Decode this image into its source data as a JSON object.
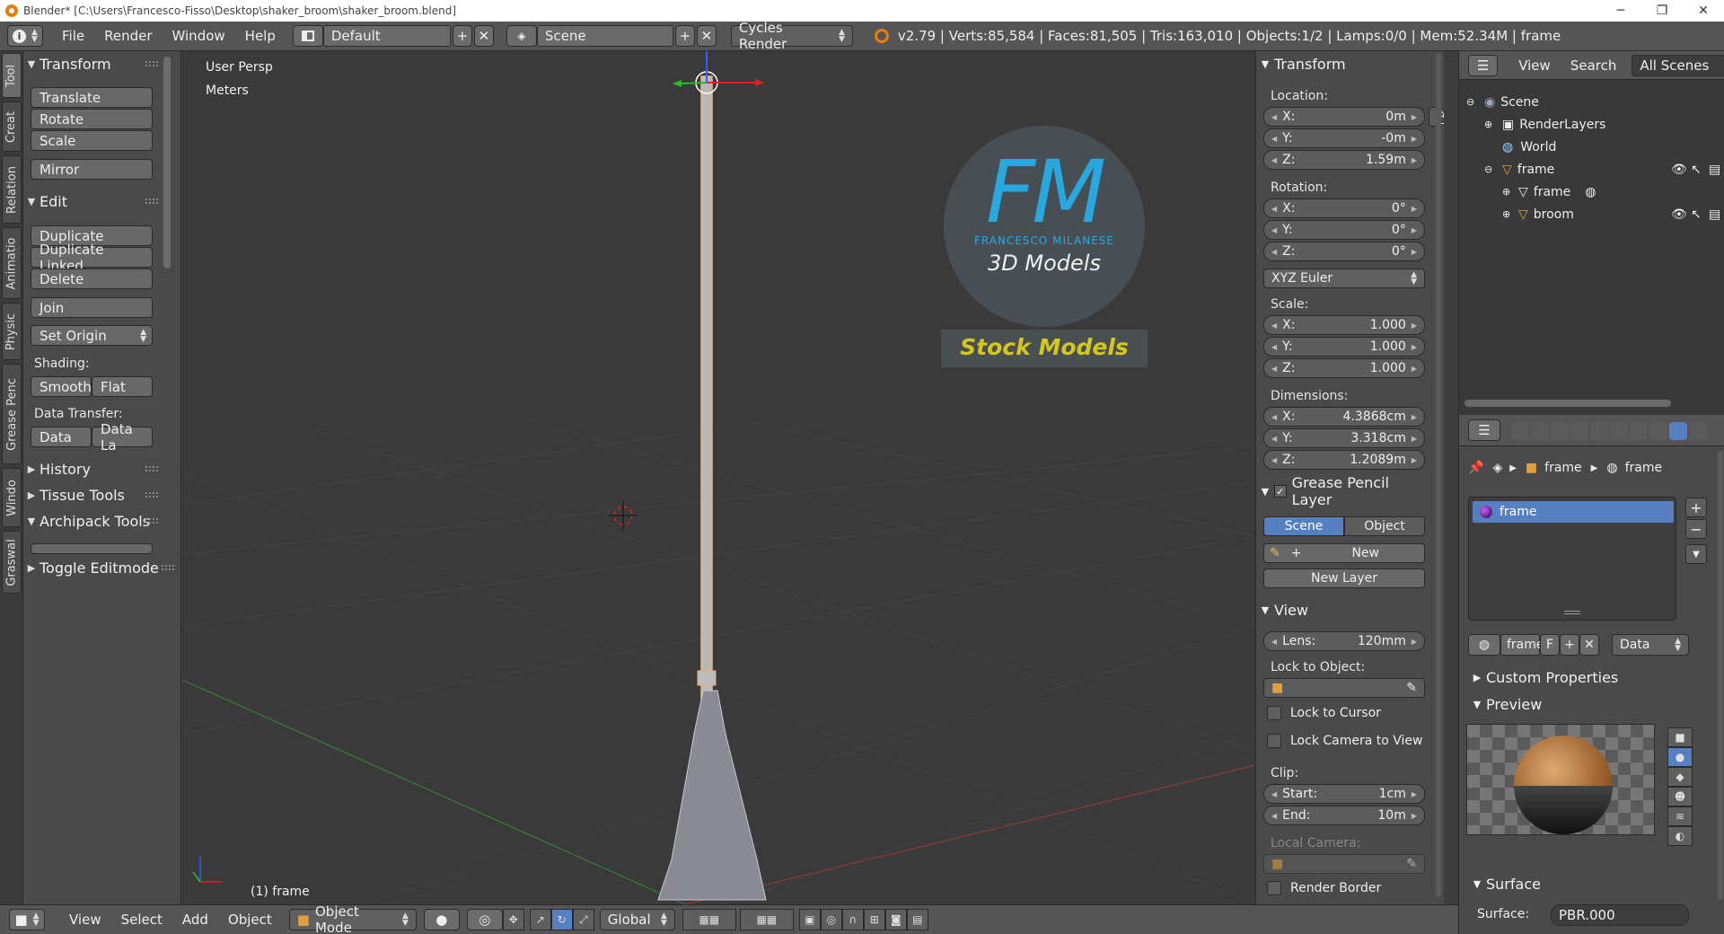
{
  "titlebar": {
    "title": "Blender* [C:\\Users\\Francesco-Fisso\\Desktop\\shaker_broom\\shaker_broom.blend]",
    "minimize": "─",
    "maximize": "❐",
    "close": "✕"
  },
  "infobar": {
    "menus": [
      "File",
      "Render",
      "Window",
      "Help"
    ],
    "layout": "Default",
    "scene": "Scene",
    "engine": "Cycles Render",
    "stats": "v2.79 | Verts:85,584 | Faces:81,505 | Tris:163,010 | Objects:1/2 | Lamps:0/0 | Mem:52.34M | frame"
  },
  "tooltabs": [
    "Tool",
    "Creat",
    "Relation",
    "Animatio",
    "Physic",
    "Grease Penc",
    "Windo",
    "Graswal"
  ],
  "toolshelf": {
    "transform": {
      "title": "Transform",
      "translate": "Translate",
      "rotate": "Rotate",
      "scale": "Scale",
      "mirror": "Mirror"
    },
    "edit": {
      "title": "Edit",
      "duplicate": "Duplicate",
      "duplicate_linked": "Duplicate Linked",
      "delete": "Delete",
      "join": "Join",
      "set_origin": "Set Origin",
      "shading_label": "Shading:",
      "smooth": "Smooth",
      "flat": "Flat",
      "data_transfer_label": "Data Transfer:",
      "data": "Data",
      "data_la": "Data La"
    },
    "history": "History",
    "tissue": "Tissue Tools",
    "archipack": "Archipack Tools",
    "toggle_editmode": "Toggle Editmode"
  },
  "viewport": {
    "view_name": "User Persp",
    "units": "Meters",
    "object_label": "(1) frame",
    "logo_initials": "FM",
    "logo_name": "FRANCESCO MILANESE",
    "logo_sub": "3D Models",
    "stock": "Stock Models"
  },
  "npanel": {
    "transform_title": "Transform",
    "location_label": "Location:",
    "location": [
      {
        "k": "X:",
        "v": "0m"
      },
      {
        "k": "Y:",
        "v": "-0m"
      },
      {
        "k": "Z:",
        "v": "1.59m"
      }
    ],
    "rotation_label": "Rotation:",
    "rotation": [
      {
        "k": "X:",
        "v": "0°"
      },
      {
        "k": "Y:",
        "v": "0°"
      },
      {
        "k": "Z:",
        "v": "0°"
      }
    ],
    "rotation_mode": "XYZ Euler",
    "scale_label": "Scale:",
    "scale": [
      {
        "k": "X:",
        "v": "1.000"
      },
      {
        "k": "Y:",
        "v": "1.000"
      },
      {
        "k": "Z:",
        "v": "1.000"
      }
    ],
    "dimensions_label": "Dimensions:",
    "dimensions": [
      {
        "k": "X:",
        "v": "4.3868cm"
      },
      {
        "k": "Y:",
        "v": "3.318cm"
      },
      {
        "k": "Z:",
        "v": "1.2089m"
      }
    ],
    "grease_title": "Grease Pencil Layer",
    "gp_scene": "Scene",
    "gp_object": "Object",
    "gp_new": "New",
    "gp_new_layer": "New Layer",
    "view_title": "View",
    "lens_label": "Lens:",
    "lens_value": "120mm",
    "lock_to_object": "Lock to Object:",
    "lock_to_cursor": "Lock to Cursor",
    "lock_camera": "Lock Camera to View",
    "clip_label": "Clip:",
    "clip_start_label": "Start:",
    "clip_start": "1cm",
    "clip_end_label": "End:",
    "clip_end": "10m",
    "local_camera": "Local Camera:",
    "render_border": "Render Border"
  },
  "outliner": {
    "view": "View",
    "search": "Search",
    "filter": "All Scenes",
    "rows": [
      "Scene",
      "RenderLayers",
      "World",
      "frame",
      "frame",
      "broom"
    ]
  },
  "props": {
    "breadcrumb_obj": "frame",
    "breadcrumb_mat": "frame",
    "material_item": "frame",
    "mat_name": "frame",
    "mat_f": "F",
    "link_mode": "Data",
    "custom_props": "Custom Properties",
    "preview": "Preview",
    "surface": "Surface",
    "surface_label": "Surface:",
    "surface_value": "PBR.000"
  },
  "bottombar": {
    "menus": [
      "View",
      "Select",
      "Add",
      "Object"
    ],
    "mode": "Object Mode",
    "orientation": "Global"
  },
  "colors": {
    "accent_blue": "#5680c2",
    "logo_blue": "#29a8e0",
    "stock_yellow": "#d4c81e"
  }
}
